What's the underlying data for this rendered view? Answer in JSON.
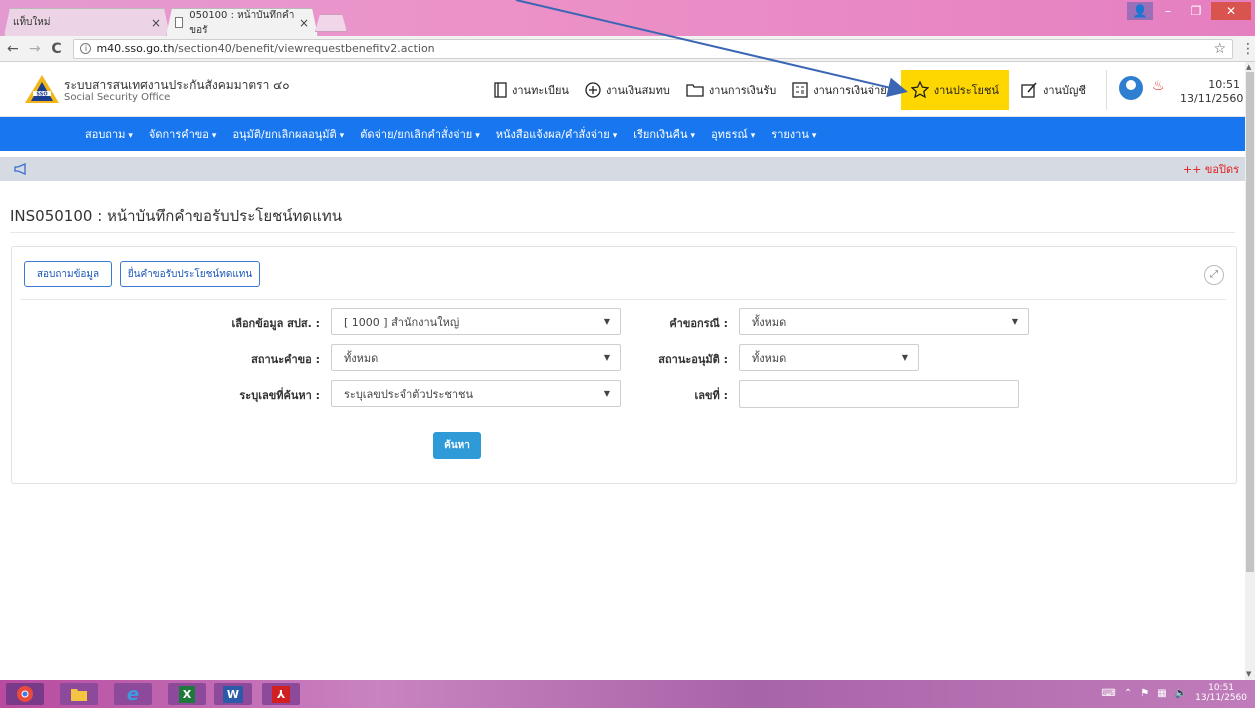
{
  "browser": {
    "tabs": [
      {
        "label": "แท็บใหม่",
        "close": "×"
      },
      {
        "label": "050100 : หน้าบันทึกคำขอรั",
        "close": "×"
      }
    ],
    "url_host": "m40.sso.go.th",
    "url_path": "/section40/benefit/viewrequestbenefitv2.action",
    "back": "←",
    "forward": "→",
    "reload": "C",
    "star": "☆",
    "menu": "⋮"
  },
  "header": {
    "brand_th": "ระบบสารสนเทศงานประกันสังคมมาตรา ๔๐",
    "brand_en": "Social Security Office",
    "nav": [
      {
        "label": "งานทะเบียน",
        "icon": "book-icon"
      },
      {
        "label": "งานเงินสมทบ",
        "icon": "plus-circle-icon"
      },
      {
        "label": "งานการเงินรับ",
        "icon": "folder-icon"
      },
      {
        "label": "งานการเงินจ่าย",
        "icon": "calculator-icon"
      },
      {
        "label": "งานประโยชน์",
        "icon": "star-icon"
      },
      {
        "label": "งานบัญชี",
        "icon": "edit-icon"
      }
    ],
    "clock_time": "10:51",
    "clock_date": "13/11/2560",
    "active_color": "#ffd700"
  },
  "menubar": {
    "items": [
      {
        "label": "สอบถาม",
        "caret": "▾"
      },
      {
        "label": "จัดการคำขอ",
        "caret": "▾"
      },
      {
        "label": "อนุมัติ/ยกเลิกผลอนุมัติ",
        "caret": "▾"
      },
      {
        "label": "ตัดจ่าย/ยกเลิกคำสั่งจ่าย",
        "caret": "▾"
      },
      {
        "label": "หนังสือแจ้งผล/คำสั่งจ่าย",
        "caret": "▾"
      },
      {
        "label": "เรียกเงินคืน",
        "caret": "▾"
      },
      {
        "label": "อุทธรณ์",
        "caret": "▾"
      },
      {
        "label": "รายงาน",
        "caret": "▾"
      }
    ],
    "color": "#1877ee"
  },
  "announce": {
    "ticker": "++ ขอปิดร"
  },
  "page": {
    "title": "INS050100 : หน้าบันทึกคำขอรับประโยชน์ทดแทน"
  },
  "panel": {
    "btn_query": "สอบถามข้อมูล",
    "btn_submit": "ยื่นคำขอรับประโยชน์ทดแทน",
    "fields": {
      "branch_label": "เลือกข้อมูล สปส. :",
      "branch_value": "[ 1000 ] สำนักงานใหญ่",
      "case_label": "คำขอกรณี :",
      "case_value": "ทั้งหมด",
      "status_label": "สถานะคำขอ :",
      "status_value": "ทั้งหมด",
      "approval_label": "สถานะอนุมัติ :",
      "approval_value": "ทั้งหมด",
      "searchby_label": "ระบุเลขที่ค้นหา :",
      "searchby_value": "ระบุเลขประจำตัวประชาชน",
      "number_label": "เลขที่ :",
      "number_value": ""
    },
    "search_btn": "ค้นหา",
    "expand": "⤢"
  },
  "taskbar": {
    "tray_time": "10:51",
    "tray_date": "13/11/2560"
  }
}
